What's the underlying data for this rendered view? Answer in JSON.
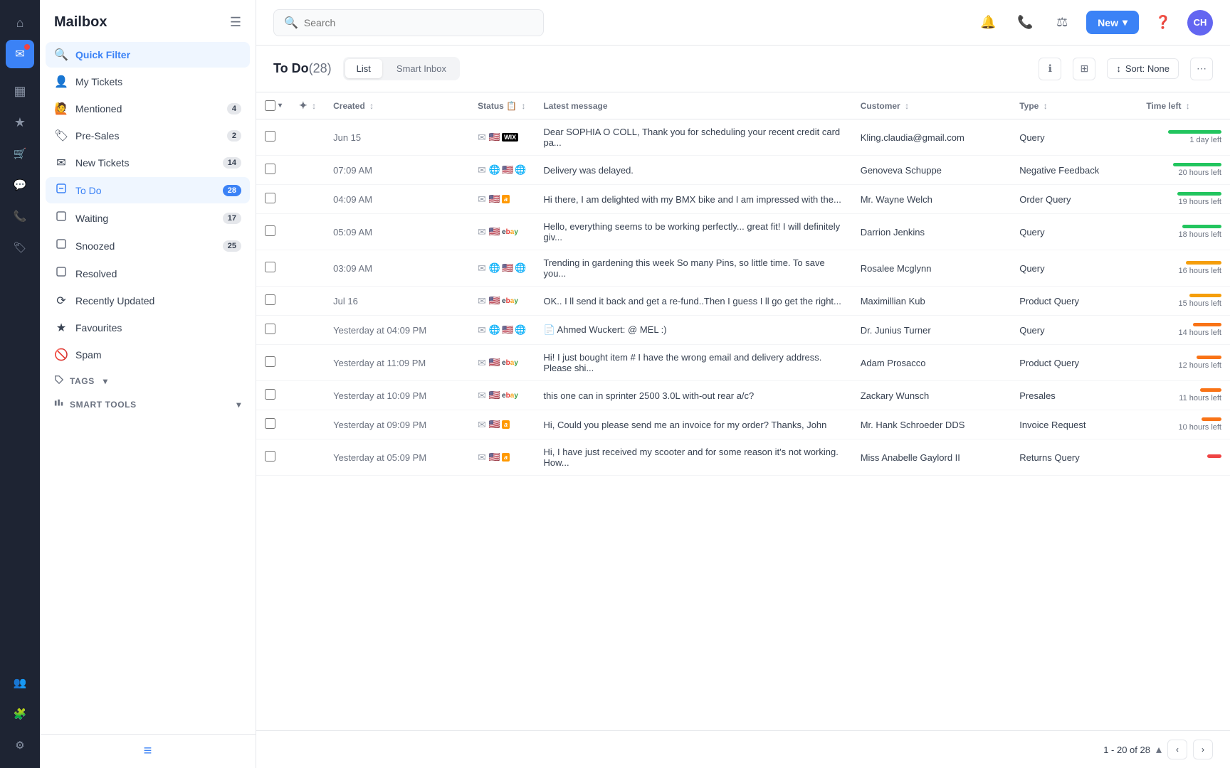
{
  "app": {
    "title": "Mailbox"
  },
  "iconBar": {
    "items": [
      {
        "name": "home-icon",
        "icon": "⌂",
        "active": false
      },
      {
        "name": "mail-icon",
        "icon": "✉",
        "active": true
      },
      {
        "name": "chart-icon",
        "icon": "▦",
        "active": false
      },
      {
        "name": "star-icon",
        "icon": "★",
        "active": false
      },
      {
        "name": "cart-icon",
        "icon": "🛒",
        "active": false
      },
      {
        "name": "chat-icon",
        "icon": "💬",
        "active": false
      },
      {
        "name": "phone-icon",
        "icon": "📞",
        "active": false
      },
      {
        "name": "tag-icon",
        "icon": "🏷",
        "active": false
      },
      {
        "name": "users-icon",
        "icon": "👥",
        "active": false
      },
      {
        "name": "puzzle-icon",
        "icon": "🧩",
        "active": false
      },
      {
        "name": "settings-icon",
        "icon": "⚙",
        "active": false
      }
    ]
  },
  "sidebar": {
    "title": "Mailbox",
    "navItems": [
      {
        "id": "quick-filter",
        "label": "Quick Filter",
        "icon": "🔍",
        "badge": null,
        "active": true
      },
      {
        "id": "my-tickets",
        "label": "My Tickets",
        "icon": "👤",
        "badge": null,
        "active": false
      },
      {
        "id": "mentioned",
        "label": "Mentioned",
        "icon": "👋",
        "badge": "4",
        "active": false
      },
      {
        "id": "pre-sales",
        "label": "Pre-Sales",
        "icon": "🏷",
        "badge": "2",
        "active": false
      },
      {
        "id": "new-tickets",
        "label": "New Tickets",
        "icon": "✉",
        "badge": "14",
        "active": false
      },
      {
        "id": "to-do",
        "label": "To Do",
        "icon": "✗",
        "badge": "28",
        "active": true
      },
      {
        "id": "waiting",
        "label": "Waiting",
        "icon": "◻",
        "badge": "17",
        "active": false
      },
      {
        "id": "snoozed",
        "label": "Snoozed",
        "icon": "◻",
        "badge": "25",
        "active": false
      },
      {
        "id": "resolved",
        "label": "Resolved",
        "icon": "◻",
        "badge": null,
        "active": false
      },
      {
        "id": "recently-updated",
        "label": "Recently Updated",
        "icon": "⟳",
        "badge": null,
        "active": false
      },
      {
        "id": "favourites",
        "label": "Favourites",
        "icon": "★",
        "badge": null,
        "active": false
      },
      {
        "id": "spam",
        "label": "Spam",
        "icon": "🚫",
        "badge": null,
        "active": false
      }
    ],
    "tags": {
      "label": "TAGS",
      "icon": "🏷"
    },
    "smartTools": {
      "label": "SMART TOOLS"
    }
  },
  "topbar": {
    "search": {
      "placeholder": "Search"
    },
    "newButton": "New",
    "avatar": "CH"
  },
  "content": {
    "title": "To Do",
    "count": "(28)",
    "viewToggle": {
      "list": "List",
      "smartInbox": "Smart Inbox"
    },
    "sort": "Sort: None",
    "columns": [
      {
        "key": "created",
        "label": "Created"
      },
      {
        "key": "status",
        "label": "Status"
      },
      {
        "key": "latest_message",
        "label": "Latest message"
      },
      {
        "key": "customer",
        "label": "Customer"
      },
      {
        "key": "type",
        "label": "Type"
      },
      {
        "key": "time_left",
        "label": "Time left"
      }
    ],
    "rows": [
      {
        "created": "Jun 15",
        "source": "wix",
        "message": "Dear SOPHIA O COLL, Thank you for scheduling your recent credit card pa...",
        "customer": "Kling.claudia@gmail.com",
        "type": "Query",
        "timeLeft": "1 day left",
        "timeColor": "#22c55e",
        "timeWidth": 75
      },
      {
        "created": "07:09 AM",
        "source": "globe",
        "message": "Delivery was delayed.",
        "customer": "Genoveva Schuppe",
        "type": "Negative Feedback",
        "timeLeft": "20 hours left",
        "timeColor": "#22c55e",
        "timeWidth": 68
      },
      {
        "created": "04:09 AM",
        "source": "amazon",
        "message": "Hi there, I am delighted with my BMX bike and I am impressed with the...",
        "customer": "Mr. Wayne Welch",
        "type": "Order Query",
        "timeLeft": "19 hours left",
        "timeColor": "#22c55e",
        "timeWidth": 62
      },
      {
        "created": "05:09 AM",
        "source": "ebay",
        "message": "Hello, everything seems to be working perfectly... great fit! I will definitely giv...",
        "customer": "Darrion Jenkins",
        "type": "Query",
        "timeLeft": "18 hours left",
        "timeColor": "#22c55e",
        "timeWidth": 55
      },
      {
        "created": "03:09 AM",
        "source": "globe",
        "message": "Trending in gardening this week So many Pins, so little time. To save you...",
        "customer": "Rosalee Mcglynn",
        "type": "Query",
        "timeLeft": "16 hours left",
        "timeColor": "#f59e0b",
        "timeWidth": 50
      },
      {
        "created": "Jul 16",
        "source": "ebay",
        "message": "OK.. I ll send it back and get a re-fund..Then I guess I ll go get the right...",
        "customer": "Maximillian Kub",
        "type": "Product Query",
        "timeLeft": "15 hours left",
        "timeColor": "#f59e0b",
        "timeWidth": 45
      },
      {
        "created": "Yesterday at 04:09 PM",
        "source": "globe",
        "message": "📄 Ahmed Wuckert: @ MEL :)",
        "customer": "Dr. Junius Turner",
        "type": "Query",
        "timeLeft": "14 hours left",
        "timeColor": "#f97316",
        "timeWidth": 40
      },
      {
        "created": "Yesterday at 11:09 PM",
        "source": "ebay",
        "message": "Hi! I just bought item # I have the wrong email and delivery address. Please shi...",
        "customer": "Adam Prosacco",
        "type": "Product Query",
        "timeLeft": "12 hours left",
        "timeColor": "#f97316",
        "timeWidth": 35
      },
      {
        "created": "Yesterday at 10:09 PM",
        "source": "ebay",
        "message": "this one can in sprinter 2500 3.0L with-out rear a/c?",
        "customer": "Zackary Wunsch",
        "type": "Presales",
        "timeLeft": "11 hours left",
        "timeColor": "#f97316",
        "timeWidth": 30
      },
      {
        "created": "Yesterday at 09:09 PM",
        "source": "amazon",
        "message": "Hi, Could you please send me an invoice for my order? Thanks, John",
        "customer": "Mr. Hank Schroeder DDS",
        "type": "Invoice Request",
        "timeLeft": "10 hours left",
        "timeColor": "#f97316",
        "timeWidth": 28
      },
      {
        "created": "Yesterday at 05:09 PM",
        "source": "amazon",
        "message": "Hi, I have just received my scooter and for some reason it's not working. How...",
        "customer": "Miss Anabelle Gaylord II",
        "type": "Returns Query",
        "timeLeft": "",
        "timeColor": "#ef4444",
        "timeWidth": 20
      }
    ],
    "pagination": {
      "current": "1 - 20 of 28",
      "total": "20 of 28"
    }
  }
}
